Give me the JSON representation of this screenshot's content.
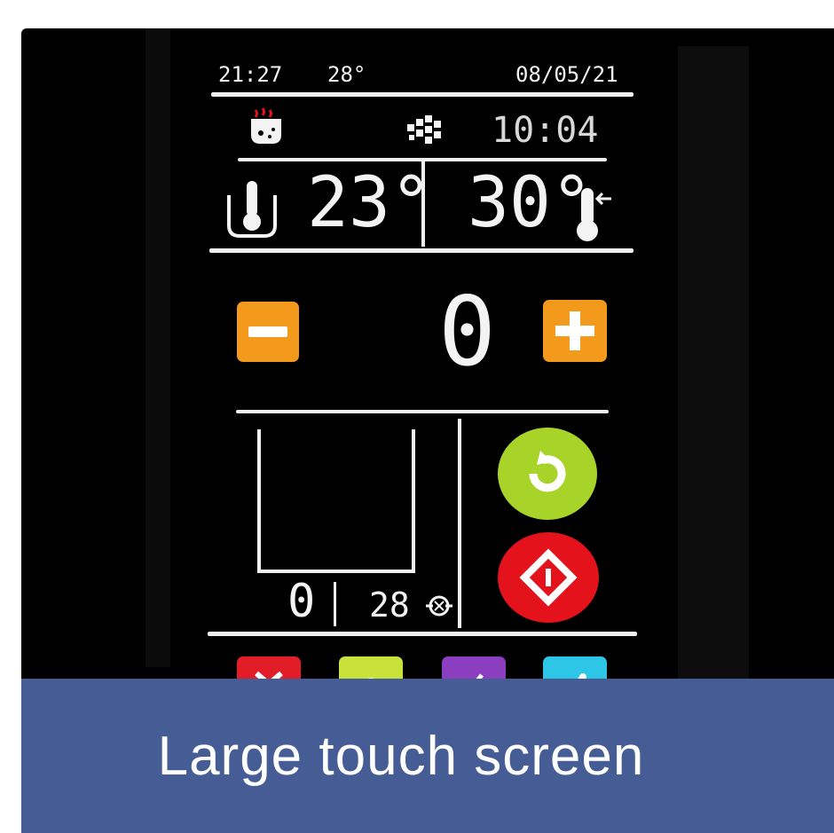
{
  "status_bar": {
    "time": "21:27",
    "outdoor_temp": "28°",
    "date": "08/05/21"
  },
  "mode_row": {
    "timer": "10:04",
    "sauna_icon": "sauna-heating-icon",
    "fan_icon": "fan-pattern-icon"
  },
  "temperatures": {
    "current": "23°",
    "target": "30°"
  },
  "setpoint": {
    "value": "0",
    "minus_label": "−",
    "plus_label": "+"
  },
  "program_panel": {
    "program_number": "0",
    "program_duration": "28"
  },
  "colors": {
    "minus": "#f39a1c",
    "plus": "#f39a1c",
    "refresh": "#a8d42a",
    "stop": "#e3121b",
    "tool1": "#e21d27",
    "tool2": "#c9e23a",
    "tool3": "#8b3ec0",
    "tool4": "#2ec6e6",
    "caption_bg": "#455d94"
  },
  "caption": "Large touch screen"
}
